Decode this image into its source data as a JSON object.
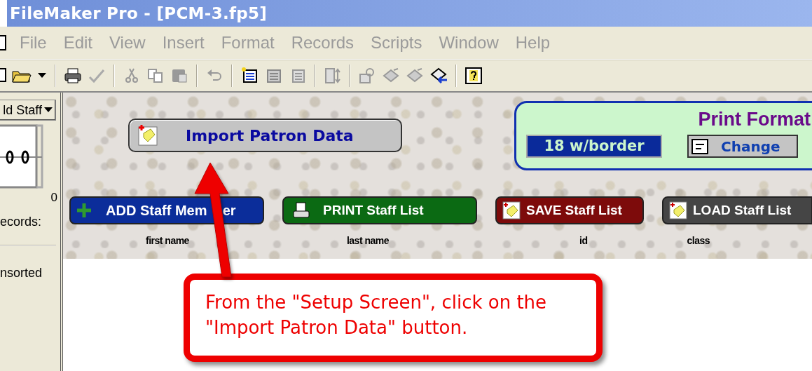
{
  "window": {
    "title": "FileMaker Pro - [PCM-3.fp5]"
  },
  "menu": [
    "File",
    "Edit",
    "View",
    "Insert",
    "Format",
    "Records",
    "Scripts",
    "Window",
    "Help"
  ],
  "sidebar": {
    "layout_menu": "ld Staff",
    "record_count": "0",
    "records_label": "ecords:",
    "sort_status": "nsorted"
  },
  "layout": {
    "import_button": "Import Patron Data",
    "print_format": {
      "title": "Print Format",
      "value": "18 w/border",
      "change_button": "Change"
    },
    "buttons": [
      {
        "label": "ADD Staff Mem    er",
        "kind": "add"
      },
      {
        "label": "PRINT Staff List",
        "kind": "print"
      },
      {
        "label": "SAVE Staff List",
        "kind": "save"
      },
      {
        "label": "LOAD Staff List",
        "kind": "load"
      }
    ],
    "columns": [
      "first name",
      "last name",
      "id",
      "class"
    ]
  },
  "callout": {
    "text": "From the \"Setup Screen\", click on the \"Import Patron Data\" button."
  }
}
